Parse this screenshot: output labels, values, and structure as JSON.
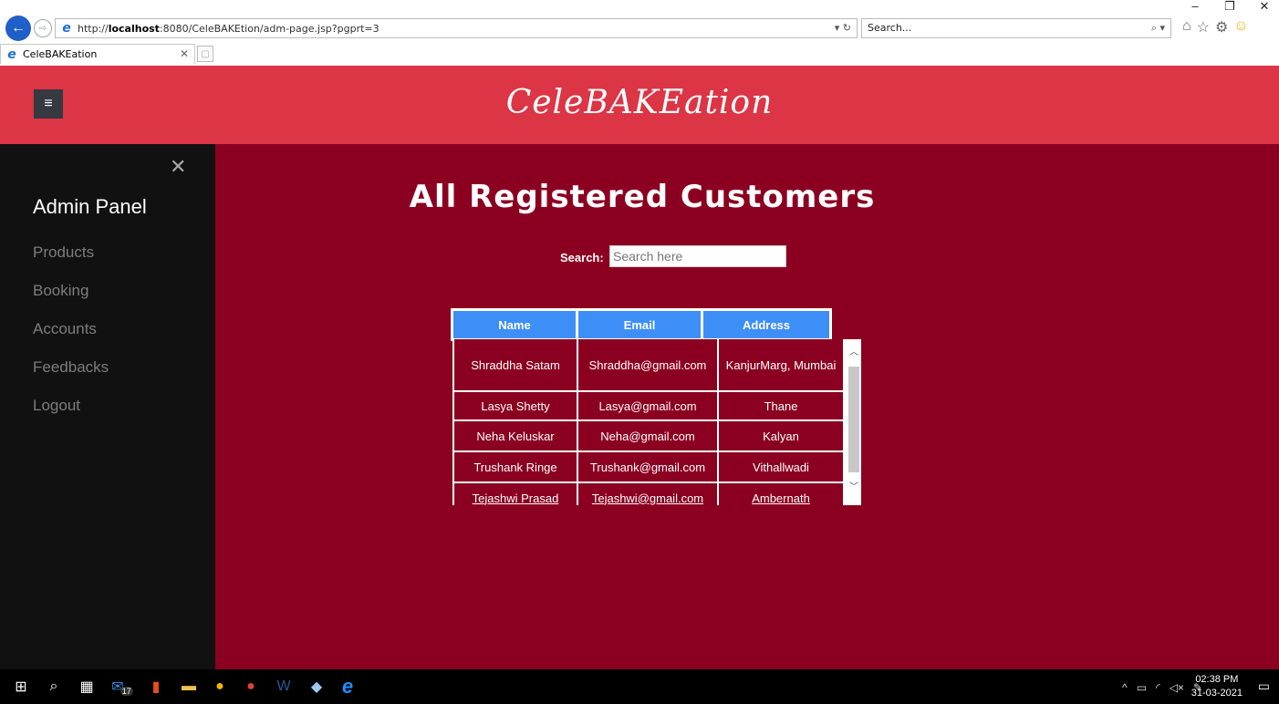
{
  "browser": {
    "url_prefix": "http://",
    "url_host": "localhost",
    "url_rest": ":8080/CeleBAKEtion/adm-page.jsp?pgprt=3",
    "search_placeholder": "Search...",
    "tab_title": "CeleBAKEation",
    "window_controls": [
      "–",
      "❐",
      "✕"
    ]
  },
  "header": {
    "brand": "CeleBAKEation",
    "menu_icon": "≡"
  },
  "sidebar": {
    "close_icon": "✕",
    "title": "Admin Panel",
    "items": [
      {
        "label": "Products"
      },
      {
        "label": "Booking"
      },
      {
        "label": "Accounts"
      },
      {
        "label": "Feedbacks"
      },
      {
        "label": "Logout"
      }
    ]
  },
  "main": {
    "title": "All Registered Customers",
    "search_label": "Search:",
    "search_placeholder": "Search here",
    "table": {
      "columns": [
        "Name",
        "Email",
        "Address"
      ],
      "rows": [
        [
          "Shraddha Satam",
          "Shraddha@gmail.com",
          "KanjurMarg, Mumbai"
        ],
        [
          "Lasya Shetty",
          "Lasya@gmail.com",
          "Thane"
        ],
        [
          "Neha Keluskar",
          "Neha@gmail.com",
          "Kalyan"
        ],
        [
          "Trushank Ringe",
          "Trushank@gmail.com",
          "Vithallwadi"
        ],
        [
          "Tejashwi Prasad",
          "Tejashwi@gmail.com",
          "Ambernath"
        ]
      ]
    }
  },
  "taskbar": {
    "mail_badge": "17",
    "time": "02:38 PM",
    "date": "31-03-2021"
  }
}
